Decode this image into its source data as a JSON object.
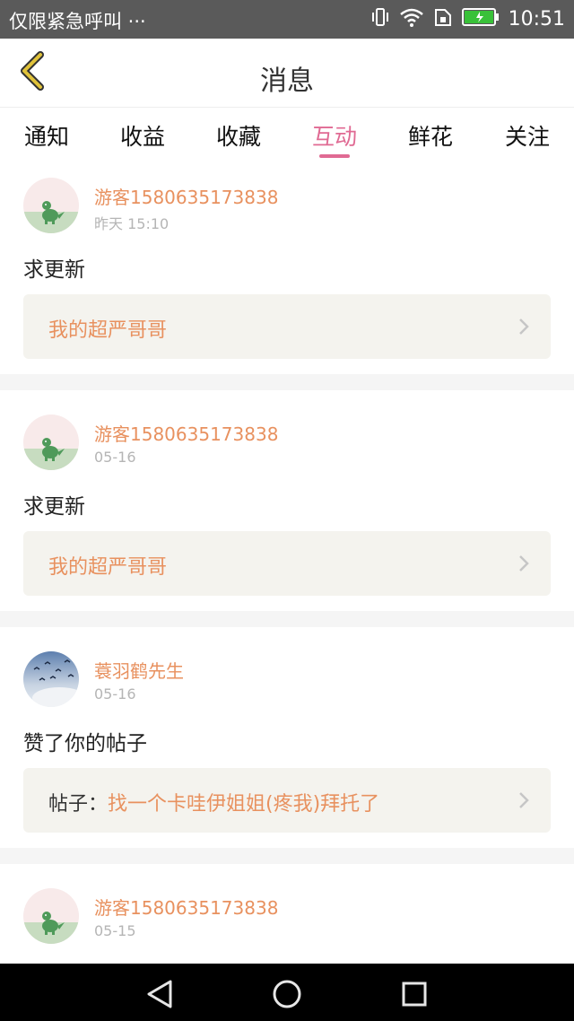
{
  "status_bar": {
    "left_text": "仅限紧急呼叫 ···",
    "time": "10:51",
    "icons": [
      "vibrate-icon",
      "wifi-icon",
      "sim-icon",
      "battery-icon"
    ],
    "battery_color": "#39c139"
  },
  "header": {
    "title": "消息",
    "back_icon": "chevron-left-icon",
    "accent": "#e0c23a"
  },
  "tabs": {
    "items": [
      {
        "label": "通知"
      },
      {
        "label": "收益"
      },
      {
        "label": "收藏"
      },
      {
        "label": "互动"
      },
      {
        "label": "鲜花"
      },
      {
        "label": "关注"
      }
    ],
    "active": "互动",
    "active_color": "#e06a93"
  },
  "messages": [
    {
      "user": "游客1580635173838",
      "time": "昨天 15:10",
      "text": "求更新",
      "avatar_icon": "dinosaur-avatar-icon",
      "ref_prefix": "",
      "ref_title": "我的超严哥哥"
    },
    {
      "user": "游客1580635173838",
      "time": "05-16",
      "text": "求更新",
      "avatar_icon": "dinosaur-avatar-icon",
      "ref_prefix": "",
      "ref_title": "我的超严哥哥"
    },
    {
      "user": "蓑羽鹤先生",
      "time": "05-16",
      "text": "赞了你的帖子",
      "avatar_icon": "birds-sky-avatar-icon",
      "ref_prefix": "帖子：",
      "ref_title": "找一个卡哇伊姐姐(疼我)拜托了"
    },
    {
      "user": "游客1580635173838",
      "time": "05-15",
      "avatar_icon": "dinosaur-avatar-icon"
    }
  ],
  "colors": {
    "username": "#e8915f",
    "ref_background": "#f4f3ee",
    "separator": "#f5f5f5"
  },
  "nav_bar": {
    "buttons": [
      "back-triangle-icon",
      "home-circle-icon",
      "recents-square-icon"
    ]
  }
}
